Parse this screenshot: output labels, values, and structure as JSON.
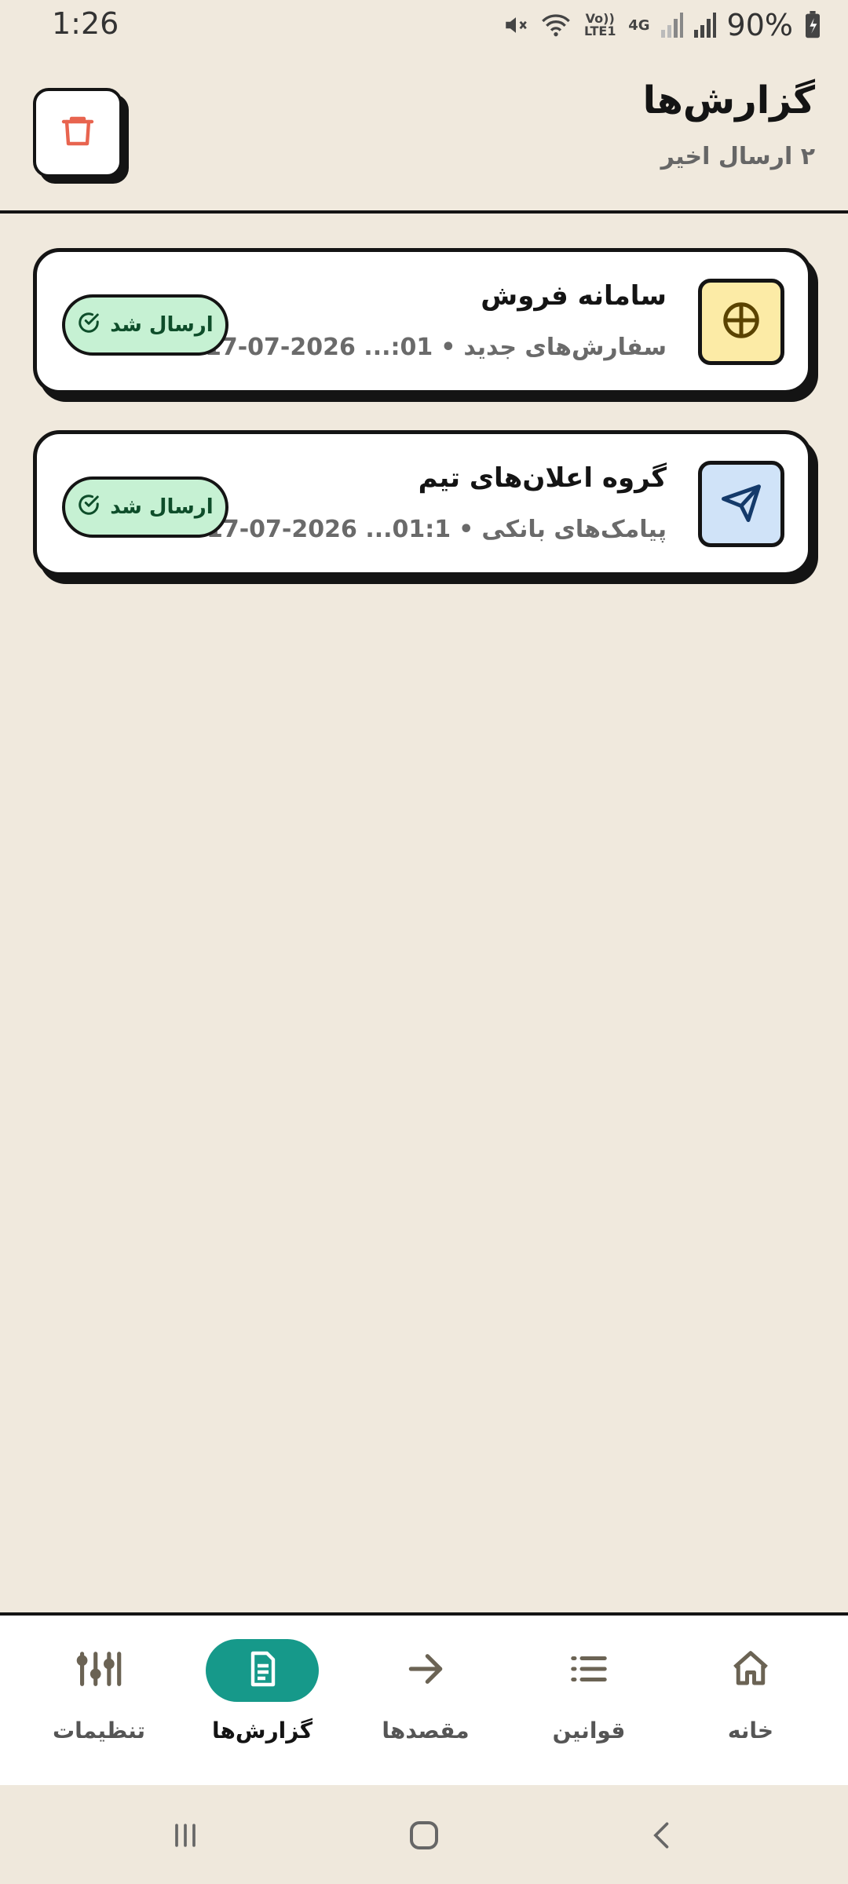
{
  "status_bar": {
    "time": "1:26",
    "battery": "90%",
    "network_labels": [
      "Vo)) LTE1",
      "4G"
    ]
  },
  "header": {
    "title": "گزارش‌ها",
    "subtitle": "۲ ارسال اخیر"
  },
  "reports": [
    {
      "title": "سامانه فروش",
      "category": "سفارش‌های جدید",
      "datetime": "17-07-2026 ...:01",
      "status": "ارسال شد",
      "icon": "globe-icon",
      "icon_bg": "#FCEBA6",
      "icon_color": "#5A4300"
    },
    {
      "title": "گروه اعلان‌های تیم",
      "category": "پیامک‌های بانکی",
      "datetime": "17-07-2026 ...01:1",
      "status": "ارسال شد",
      "icon": "send-icon",
      "icon_bg": "#D0E3F8",
      "icon_color": "#143A6A"
    }
  ],
  "bottom_nav": {
    "items": [
      {
        "label": "خانه",
        "icon": "home-icon"
      },
      {
        "label": "قوانین",
        "icon": "list-icon"
      },
      {
        "label": "مقصدها",
        "icon": "arrow-right-icon"
      },
      {
        "label": "گزارش‌ها",
        "icon": "document-icon",
        "active": true
      },
      {
        "label": "تنظیمات",
        "icon": "sliders-icon"
      }
    ]
  },
  "colors": {
    "background": "#F0E9DD",
    "accent": "#16998A",
    "danger": "#E8644F",
    "success_bg": "#C6F1D3",
    "success_text": "#0E4D2A"
  }
}
